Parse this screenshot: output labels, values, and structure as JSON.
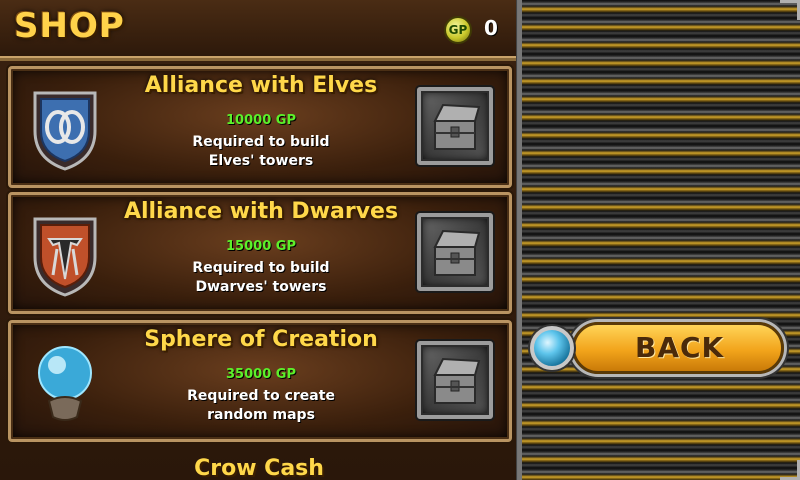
{
  "header": {
    "title": "SHOP",
    "currency_icon_label": "GP",
    "currency_amount": "0"
  },
  "items": [
    {
      "name": "Alliance with Elves",
      "cost": "10000 GP",
      "desc_line1": "Required to build",
      "desc_line2": "Elves' towers",
      "icon": "elves-shield-icon"
    },
    {
      "name": "Alliance with Dwarves",
      "cost": "15000 GP",
      "desc_line1": "Required to build",
      "desc_line2": "Dwarves' towers",
      "icon": "dwarves-shield-icon"
    },
    {
      "name": "Sphere of Creation",
      "cost": "35000 GP",
      "desc_line1": "Required to create",
      "desc_line2": "random maps",
      "icon": "crystal-ball-icon"
    }
  ],
  "partial_item_name": "Crow Cash",
  "back_button": {
    "label": "BACK"
  },
  "colors": {
    "title": "#ffd24a",
    "cost": "#5cf02a",
    "back_button": "#f2a41b"
  }
}
